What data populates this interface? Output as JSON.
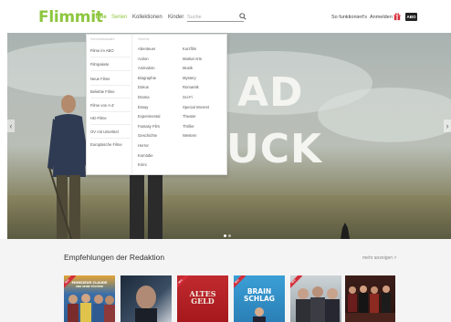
{
  "header": {
    "logo": "Flimmit",
    "nav": [
      "Filme",
      "Serien",
      "Kollektionen",
      "Kinder"
    ],
    "search_placeholder": "Suche",
    "how_it_works": "So funktioniert's",
    "login": "Anmelden",
    "abo": "ABO"
  },
  "dropdown": {
    "left_heading": "Schnellauswahl",
    "left_items": [
      "Filme im ABO",
      "Filmpakete",
      "Neue Filme",
      "Beliebte Filme",
      "Filme von A-Z",
      "HD-Filme",
      "OV mit Untertitel",
      "Europäische Filme"
    ],
    "genre_heading": "Genres",
    "genre_col1": [
      "Abenteuer",
      "Action",
      "Animation",
      "Biographie",
      "Dokus",
      "Drama",
      "Essay",
      "Experimental",
      "Fantasy Film",
      "Geschichte",
      "Horror",
      "Komödie",
      "Krimi"
    ],
    "genre_col2": [
      "Kurzfilm",
      "Martial Arts",
      "Musik",
      "Mystery",
      "Romantik",
      "Sci-Fi",
      "Special Interest",
      "Theater",
      "Thriller",
      "Western"
    ]
  },
  "hero": {
    "title_line1": "AD",
    "title_line2": "UCK",
    "slides_total": 2,
    "slide_active": 1
  },
  "section": {
    "title": "Empfehlungen der Redaktion",
    "more_link": "mehr anzeigen >"
  },
  "thumbs": [
    {
      "text": "MONSIEUR CLAUDE",
      "sub": "UND SEINE TÖCHTER",
      "banner": "NEU"
    },
    {
      "text": "",
      "sub": "",
      "banner": ""
    },
    {
      "text": "ALTES GELD",
      "sub": "",
      "banner": "NEU"
    },
    {
      "text": "BRAIN SCHLAG",
      "sub": "",
      "banner": "NEU"
    },
    {
      "text": "",
      "sub": "",
      "banner": "NEU"
    },
    {
      "text": "",
      "sub": "",
      "banner": ""
    }
  ],
  "colors": {
    "brand": "#8dc63f",
    "badge": "#d42e3a"
  }
}
